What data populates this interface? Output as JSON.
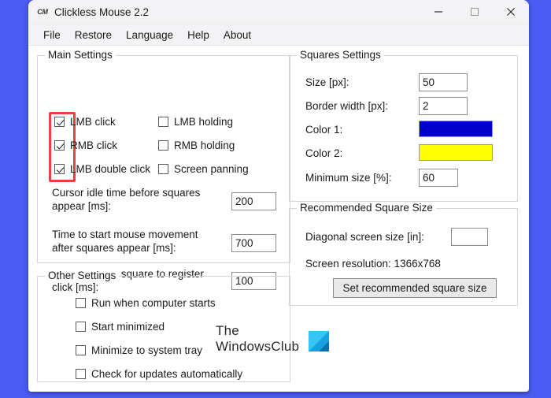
{
  "window": {
    "title": "Clickless Mouse 2.2",
    "icon_label": "CM",
    "icon_name": "app-icon-cm",
    "controls": {
      "minimize": "minimize-icon",
      "maximize": "maximize-icon",
      "close": "close-icon"
    }
  },
  "menubar": {
    "items": [
      {
        "label": "File"
      },
      {
        "label": "Restore"
      },
      {
        "label": "Language"
      },
      {
        "label": "Help"
      },
      {
        "label": "About"
      }
    ]
  },
  "main_settings": {
    "title": "Main Settings",
    "checkboxes_left": [
      {
        "label": "LMB click",
        "checked": true
      },
      {
        "label": "RMB click",
        "checked": true
      },
      {
        "label": "LMB double click",
        "checked": true
      }
    ],
    "checkboxes_right": [
      {
        "label": "LMB holding",
        "checked": false
      },
      {
        "label": "RMB holding",
        "checked": false
      },
      {
        "label": "Screen panning",
        "checked": false
      }
    ],
    "fields": [
      {
        "label_line1": "Cursor idle time before squares",
        "label_line2": "appear [ms]:",
        "value": "200"
      },
      {
        "label_line1": "Time to start mouse movement",
        "label_line2": "after squares appear [ms]:",
        "value": "700"
      },
      {
        "label_line1": "Cursor time in square to register",
        "label_line2": "click [ms]:",
        "value": "100"
      }
    ],
    "highlight_color": "#e8413c"
  },
  "other_settings": {
    "title": "Other Settings",
    "checkboxes": [
      {
        "label": "Run when computer starts",
        "checked": false
      },
      {
        "label": "Start minimized",
        "checked": false
      },
      {
        "label": "Minimize to system tray",
        "checked": false
      },
      {
        "label": "Check for updates automatically",
        "checked": false
      }
    ]
  },
  "squares_settings": {
    "title": "Squares Settings",
    "rows": [
      {
        "label": "Size [px]:",
        "value": "50",
        "kind": "text"
      },
      {
        "label": "Border width [px]:",
        "value": "2",
        "kind": "text"
      },
      {
        "label": "Color 1:",
        "value": "#0000CC",
        "kind": "color"
      },
      {
        "label": "Color 2:",
        "value": "#FFFF00",
        "kind": "color"
      },
      {
        "label": "Minimum size [%]:",
        "value": "60",
        "kind": "text"
      }
    ]
  },
  "recommended_square_size": {
    "title": "Recommended Square Size",
    "diagonal_label": "Diagonal screen size [in]:",
    "diagonal_value": "",
    "diagonal_placeholder": "",
    "resolution_text": "Screen resolution: 1366x768",
    "button_label": "Set recommended square size"
  },
  "watermark": {
    "line1": "The",
    "line2": "WindowsClub",
    "logo_name": "windowsclub-logo"
  }
}
